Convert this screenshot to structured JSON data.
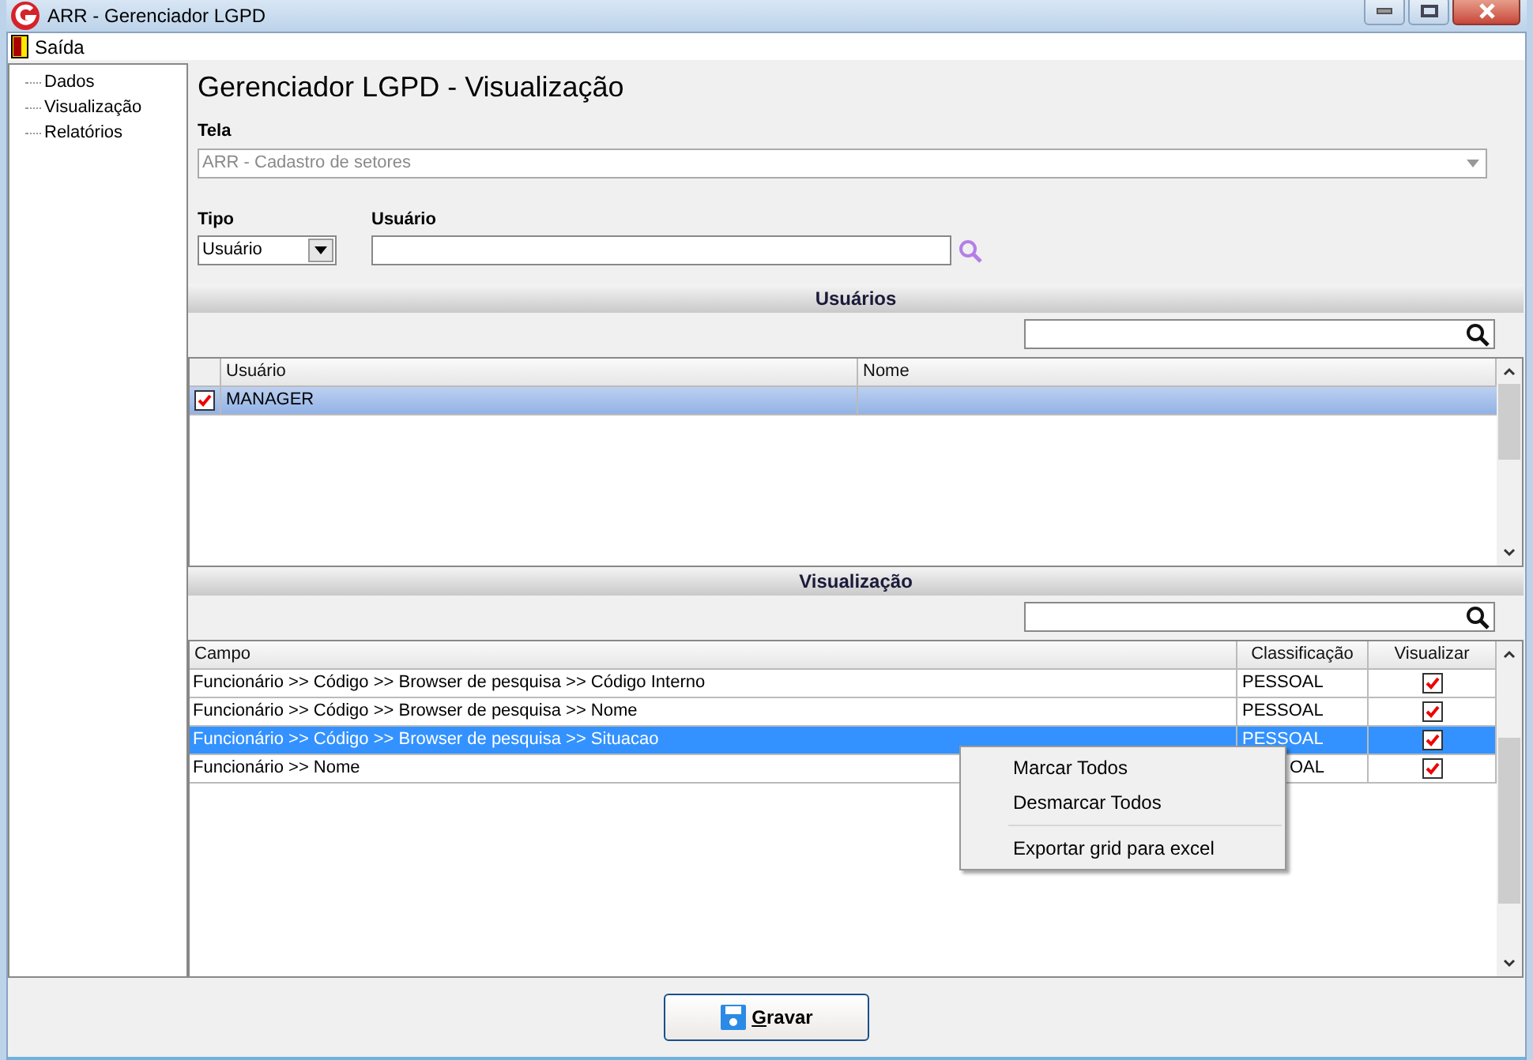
{
  "window": {
    "title": "ARR - Gerenciador LGPD"
  },
  "menu": [
    {
      "label": "Saída"
    }
  ],
  "sidebar": {
    "items": [
      {
        "label": "Dados"
      },
      {
        "label": "Visualização"
      },
      {
        "label": "Relatórios"
      }
    ]
  },
  "heading": "Gerenciador LGPD - Visualização",
  "tela": {
    "label": "Tela",
    "value": "ARR - Cadastro de setores",
    "disabled": true
  },
  "tipo": {
    "label": "Tipo",
    "value": "Usuário"
  },
  "usuario": {
    "label": "Usuário"
  },
  "users_section": {
    "title": "Usuários",
    "columns": [
      "Usuário",
      "Nome"
    ],
    "rows": [
      {
        "checked": true,
        "usuario": "MANAGER",
        "selected": true
      }
    ]
  },
  "view_section": {
    "title": "Visualização",
    "columns": [
      "Campo",
      "Classificação",
      "Visualizar"
    ],
    "rows": [
      {
        "campo": "Funcionário >> Código >> Browser de pesquisa >> Código Interno",
        "classificacao": "PESSOAL",
        "visualizar": true,
        "selected": false
      },
      {
        "campo": "Funcionário >> Código >> Browser de pesquisa >> Nome",
        "classificacao": "PESSOAL",
        "visualizar": true,
        "selected": false
      },
      {
        "campo": "Funcionário >> Código >> Browser de pesquisa >> Situacao",
        "classificacao": "PESSOAL",
        "visualizar": true,
        "selected": true
      },
      {
        "campo": "Funcionário >> Nome",
        "classificacao": "OAL",
        "visualizar": true,
        "selected": false
      }
    ]
  },
  "context_menu": {
    "items": [
      {
        "label": "Marcar Todos",
        "separator_before": false
      },
      {
        "label": "Desmarcar Todos",
        "separator_before": false
      },
      {
        "label": "Exportar grid para excel",
        "separator_before": true
      }
    ]
  },
  "save_button": {
    "label": "Gravar"
  }
}
